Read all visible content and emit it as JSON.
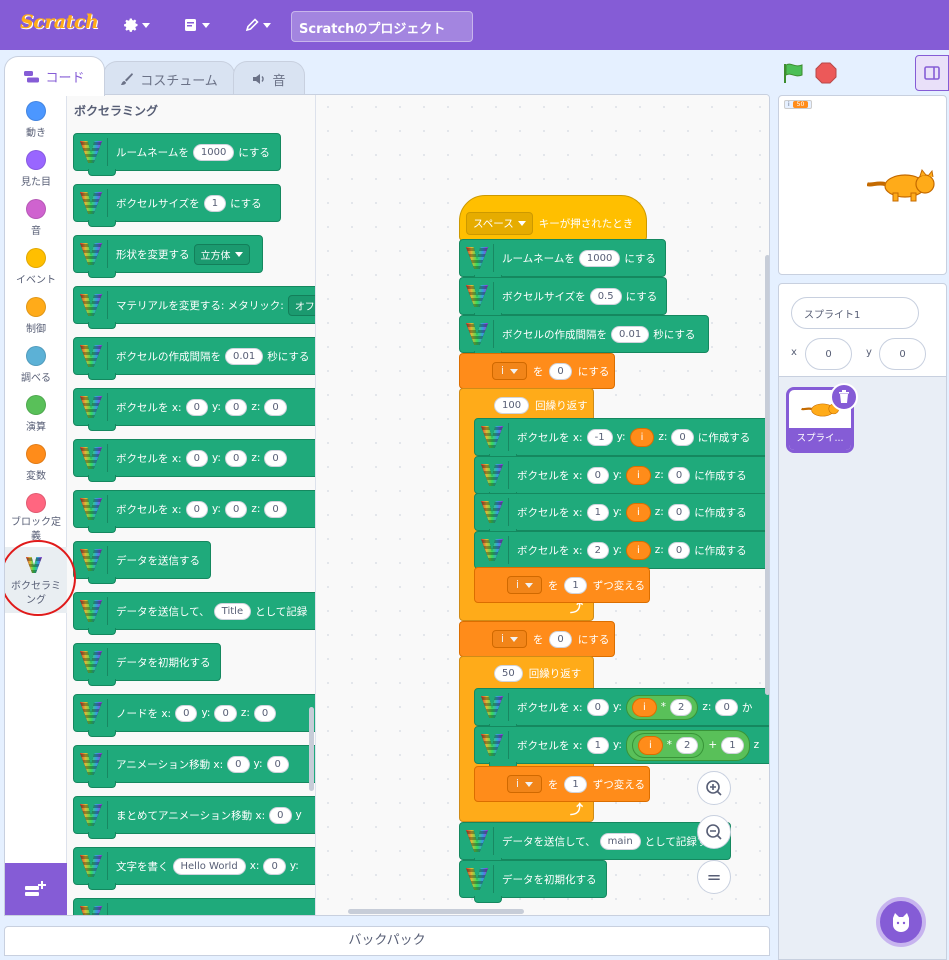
{
  "app": {
    "logo": "Scratch",
    "project_title": "Scratchのプロジェクト"
  },
  "tabs": [
    "コード",
    "コスチューム",
    "音"
  ],
  "categories": [
    "動き",
    "見た目",
    "音",
    "イベント",
    "制御",
    "調べる",
    "演算",
    "変数",
    "ブロック定義",
    "ボクセラミング"
  ],
  "colors": {
    "motion": "#4c97ff",
    "looks": "#9966ff",
    "sound": "#cf63cf",
    "events": "#ffbf00",
    "control": "#ffab19",
    "sensing": "#5cb1d6",
    "operators": "#59c059",
    "variables": "#ff8c1a",
    "myblocks": "#ff6680",
    "voxel": "#1faa7b",
    "accent": "#855cd6"
  },
  "palette": {
    "title": "ボクセラミング",
    "blocks": [
      {
        "parts": [
          "ルームネームを",
          "1000",
          "にする"
        ]
      },
      {
        "parts": [
          "ボクセルサイズを",
          "1",
          "にする"
        ]
      },
      {
        "parts": [
          "形状を変更する",
          "立方体"
        ]
      },
      {
        "parts": [
          "マテリアルを変更する: メタリック:",
          "オフ"
        ]
      },
      {
        "parts": [
          "ボクセルの作成間隔を",
          "0.01",
          "秒にする"
        ]
      },
      {
        "parts": [
          "ボクセルを x:",
          "0",
          "y:",
          "0",
          "z:",
          "0"
        ]
      },
      {
        "parts": [
          "ボクセルを x:",
          "0",
          "y:",
          "0",
          "z:",
          "0"
        ]
      },
      {
        "parts": [
          "ボクセルを x:",
          "0",
          "y:",
          "0",
          "z:",
          "0"
        ]
      },
      {
        "parts": [
          "データを送信する"
        ]
      },
      {
        "parts": [
          "データを送信して、",
          "Title",
          "として記録"
        ]
      },
      {
        "parts": [
          "データを初期化する"
        ]
      },
      {
        "parts": [
          "ノードを x:",
          "0",
          "y:",
          "0",
          "z:",
          "0"
        ]
      },
      {
        "parts": [
          "アニメーション移動 x:",
          "0",
          "y:",
          "0"
        ]
      },
      {
        "parts": [
          "まとめてアニメーション移動 x:",
          "0",
          "y"
        ]
      },
      {
        "parts": [
          "文字を書く",
          "Hello World",
          "x:",
          "0",
          "y:"
        ]
      }
    ]
  },
  "script": {
    "hat": {
      "key": "スペース",
      "text": "キーが押されたとき"
    },
    "room": {
      "label": "ルームネームを",
      "value": "1000",
      "suffix": "にする"
    },
    "size": {
      "label": "ボクセルサイズを",
      "value": "0.5",
      "suffix": "にする"
    },
    "interval": {
      "label": "ボクセルの作成間隔を",
      "value": "0.01",
      "suffix": "秒にする"
    },
    "set_i_1": {
      "var": "i",
      "to": "を",
      "value": "0",
      "suffix": "にする"
    },
    "repeat1": {
      "count": "100",
      "label": "回繰り返す"
    },
    "voxel_rows1": [
      {
        "x": "-1",
        "z": "0"
      },
      {
        "x": "0",
        "z": "0"
      },
      {
        "x": "1",
        "z": "0"
      },
      {
        "x": "2",
        "z": "0"
      }
    ],
    "voxel_lbl": {
      "prefix": "ボクセルを x:",
      "y": "y:",
      "z": "z:",
      "suffix": "に作成する",
      "var": "i"
    },
    "change_i": {
      "var": "i",
      "to": "を",
      "value": "1",
      "suffix": "ずつ変える"
    },
    "set_i_2": {
      "var": "i",
      "to": "を",
      "value": "0",
      "suffix": "にする"
    },
    "repeat2": {
      "count": "50",
      "label": "回繰り返す"
    },
    "voxel_rows2": [
      {
        "x": "0",
        "mul": "2",
        "z": "0",
        "tail": "か"
      },
      {
        "x": "1",
        "mul": "2",
        "plus": "1",
        "tail": "z"
      }
    ],
    "change_i2": {
      "var": "i",
      "to": "を",
      "value": "1",
      "suffix": "ずつ変える"
    },
    "send": {
      "label": "データを送信して、",
      "value": "main",
      "suffix": "として記録する"
    },
    "init": {
      "label": "データを初期化する"
    },
    "ops": {
      "times": "*",
      "plus": "+"
    }
  },
  "stage": {
    "monitor_name": "i",
    "monitor_value": "50"
  },
  "sprite": {
    "name": "スプライト1",
    "x_label": "x",
    "x": "0",
    "y_label": "y",
    "y": "0",
    "thumb_label": "スプライ..."
  },
  "backpack": "バックパック",
  "zoom": {
    "reset": "="
  }
}
